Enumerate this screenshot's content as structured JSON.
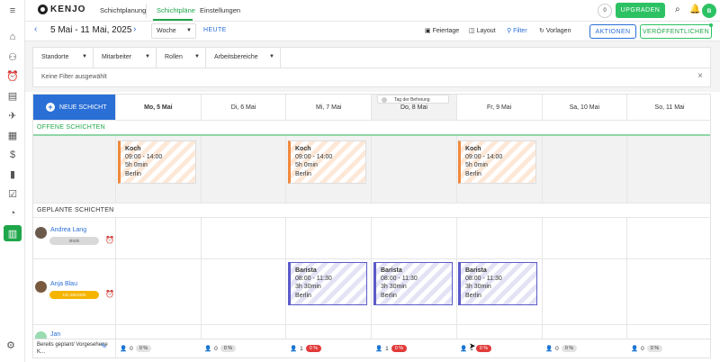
{
  "app": {
    "logo": "KENJO"
  },
  "topnav": {
    "schichtplanung": "Schichtplanung",
    "schichtplaene": "Schichtpläne",
    "einstellungen": "Einstellungen",
    "counter": "0",
    "upgrade": "UPGRADEN",
    "avatar": "B"
  },
  "toolbar": {
    "prev": "‹",
    "daterange": "5 Mai - 11 Mai, 2025",
    "next": "›",
    "view": "Woche",
    "today": "HEUTE",
    "feiertage": "Feiertage",
    "layout": "Layout",
    "filter": "Filter",
    "vorlagen": "Vorlagen",
    "aktionen": "AKTIONEN",
    "publish": "VERÖFFENTLICHEN"
  },
  "filters": {
    "items": [
      "Standorte",
      "Mitarbeiter",
      "Rollen",
      "Arbeitsbereiche"
    ],
    "none": "Keine Filter ausgewählt",
    "close": "×"
  },
  "grid": {
    "new_shift": "NEUE SCHICHT",
    "holiday_toggle": "Tag der Befreiung",
    "days": [
      "Mo, 5 Mai",
      "Di, 6 Mai",
      "Mi, 7 Mai",
      "Do, 8 Mai",
      "Fr, 9 Mai",
      "Sa, 10 Mai",
      "So, 11 Mai"
    ],
    "open_label": "OFFENE SCHICHTEN",
    "planned_label": "GEPLANTE SCHICHTEN",
    "open_shifts": [
      {
        "role": "Koch",
        "time": "09:00 - 14:00",
        "duration": "5h 0min",
        "location": "Berlin"
      },
      {
        "role": "Koch",
        "time": "09:00 - 14:00",
        "duration": "5h 0min",
        "location": "Berlin"
      },
      {
        "role": "Koch",
        "time": "09:00 - 14:00",
        "duration": "5h 0min",
        "location": "Berlin"
      }
    ],
    "employees": [
      {
        "name": "Andrea Lang",
        "hours": "0h/0h",
        "pill_color": "#d9d9d9"
      },
      {
        "name": "Anja Blau",
        "hours": "11h 30m/40h",
        "pill_color": "#f5b400"
      },
      {
        "name": "Jan",
        "hours": "",
        "pill_color": "#d9d9d9"
      }
    ],
    "planned_shifts": [
      {
        "role": "Barista",
        "time": "08:00 - 11:30",
        "duration": "3h 30min",
        "location": "Berlin"
      },
      {
        "role": "Barista",
        "time": "08:00 - 11:30",
        "duration": "3h 30min",
        "location": "Berlin"
      },
      {
        "role": "Barista",
        "time": "08:00 - 11:30",
        "duration": "3h 30min",
        "location": "Berlin"
      }
    ],
    "footer_label": "Bereits geplant/ Vorgesehene K...",
    "footer": [
      {
        "people": "0",
        "pct": "0 %",
        "status": "grey"
      },
      {
        "people": "0",
        "pct": "0 %",
        "status": "grey"
      },
      {
        "people": "1",
        "pct": "0 %",
        "status": "red"
      },
      {
        "people": "1",
        "pct": "0 %",
        "status": "red"
      },
      {
        "people": "1",
        "pct": "0 %",
        "status": "red"
      },
      {
        "people": "0",
        "pct": "0 %",
        "status": "grey"
      },
      {
        "people": "0",
        "pct": "0 %",
        "status": "grey"
      }
    ]
  },
  "icons": {
    "sidebar": [
      "menu-icon",
      "home-icon",
      "people-icon",
      "alarm-icon",
      "document-icon",
      "plane-icon",
      "calendar-icon",
      "dollar-icon",
      "chart-icon",
      "checklist-icon",
      "gauge-icon",
      "shift-planner-icon",
      "settings-icon"
    ]
  },
  "colors": {
    "accent_green": "#2cc263",
    "accent_blue": "#2a6fd6",
    "open_orange": "#f08a3e",
    "planned_purple": "#5b5bc9",
    "alert_red": "#e23b3b"
  }
}
